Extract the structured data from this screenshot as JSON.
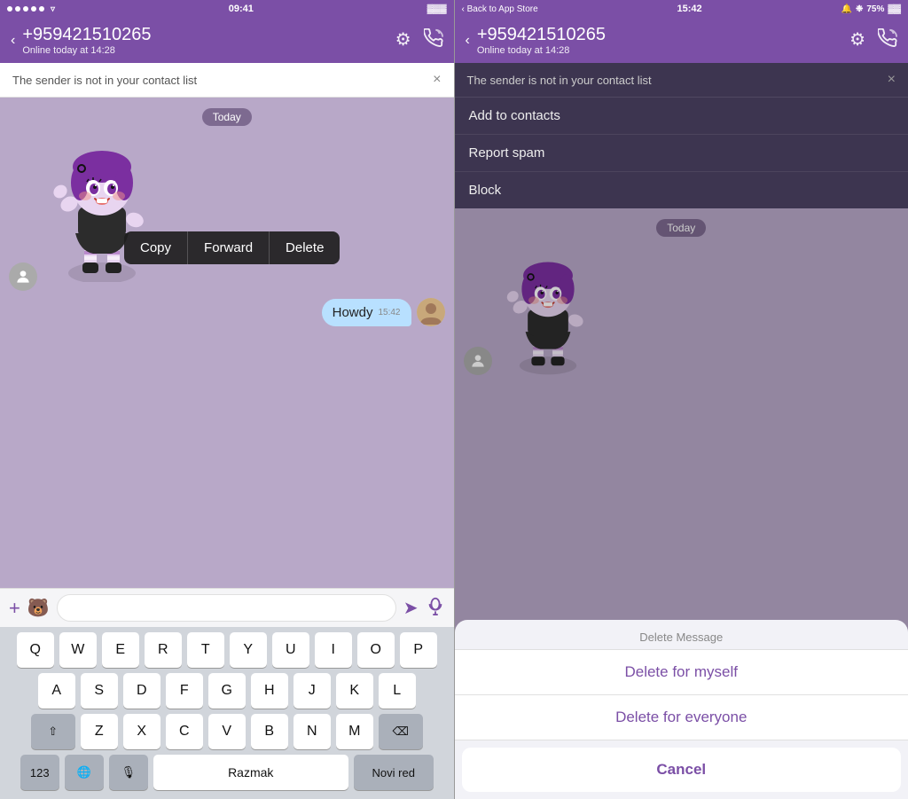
{
  "left": {
    "status_bar": {
      "dots": 5,
      "wifi": "wifi",
      "time": "09:41",
      "battery": "battery"
    },
    "header": {
      "back_label": "‹",
      "phone": "+959421510265",
      "status": "Online today at 14:28",
      "settings_icon": "gear",
      "call_icon": "phone"
    },
    "notification": {
      "text": "The sender is not in your contact list",
      "close": "×"
    },
    "chat": {
      "date_badge": "Today",
      "sticker_alt": "Purple girl sticker",
      "outgoing_text": "Howdy",
      "outgoing_time": "15:42"
    },
    "context_menu": {
      "copy": "Copy",
      "forward": "Forward",
      "delete": "Delete"
    },
    "input": {
      "placeholder": "",
      "add_icon": "+",
      "sticker_icon": "🐻",
      "send_icon": "➤",
      "mic_icon": "🎤"
    },
    "keyboard": {
      "row1": [
        "Q",
        "W",
        "E",
        "R",
        "T",
        "Y",
        "U",
        "I",
        "O",
        "P"
      ],
      "row2": [
        "A",
        "S",
        "D",
        "F",
        "G",
        "H",
        "J",
        "K",
        "L"
      ],
      "row3": [
        "Z",
        "X",
        "C",
        "V",
        "B",
        "N",
        "M"
      ],
      "bottom": {
        "num": "123",
        "globe": "🌐",
        "mic": "🎙",
        "space": "Razmak",
        "return": "Novi red"
      },
      "shift": "⇧",
      "delete": "⌫"
    }
  },
  "right": {
    "status_bar": {
      "back_to_store": "‹ Back to App Store",
      "time": "15:42",
      "alarm_icon": "🔔",
      "bluetooth_icon": "❉",
      "battery": "75%"
    },
    "header": {
      "back_label": "‹",
      "phone": "+959421510265",
      "status": "Online today at 14:28",
      "settings_icon": "gear",
      "call_icon": "phone"
    },
    "notification": {
      "text": "The sender is not in your contact list",
      "close": "×"
    },
    "dropdown": {
      "add_contacts": "Add to contacts",
      "report_spam": "Report spam",
      "block": "Block"
    },
    "chat": {
      "date_badge": "Today"
    },
    "delete_dialog": {
      "title": "Delete Message",
      "for_myself": "Delete for myself",
      "for_everyone": "Delete for everyone",
      "cancel": "Cancel"
    }
  }
}
